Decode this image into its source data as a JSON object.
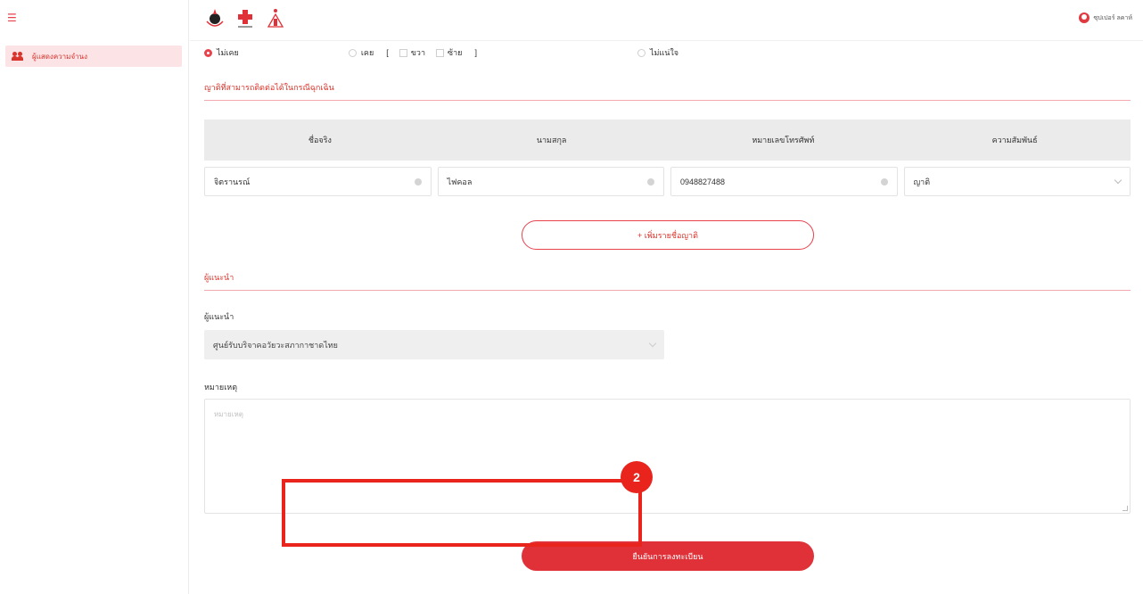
{
  "sidebar": {
    "items": [
      {
        "label": "ผู้แสดงความจำนง"
      }
    ]
  },
  "header": {
    "user_name": "ซุปเปอร์ ลคาห์"
  },
  "form": {
    "history_options": [
      {
        "label": "ไม่เคย",
        "selected": true
      },
      {
        "label": "เคย",
        "selected": false
      },
      {
        "label": "ไม่แน่ใจ",
        "selected": false
      }
    ],
    "side_open": "[",
    "side_close": "]",
    "side_right": "ขวา",
    "side_left": "ซ้าย",
    "relatives_section_title": "ญาติที่สามารถติดต่อได้ในกรณีฉุกเฉิน",
    "table_headers": [
      "ชื่อจริง",
      "นามสกุล",
      "หมายเลขโทรศัพท์",
      "ความสัมพันธ์"
    ],
    "relative_row": {
      "first_name": "จิตรานรณ์",
      "last_name": "ไฟคอล",
      "phone": "0948827488",
      "relation": "ญาติ"
    },
    "add_relative_label": "+ เพิ่มรายชื่อญาติ",
    "referrer_section_title": "ผู้แนะนำ",
    "referrer_label": "ผู้แนะนำ",
    "referrer_value": "ศูนย์รับบริจาคอวัยวะสภากาชาดไทย",
    "note_label": "หมายเหตุ",
    "note_placeholder": "หมายเหตุ",
    "submit_label": "ยืนยันการลงทะเบียน"
  },
  "annotation": {
    "step_number": "2",
    "color": "#e8241d"
  },
  "colors": {
    "accent": "#e03138",
    "accent_light": "#fbe3e6",
    "table_header_bg": "#ebebeb"
  }
}
